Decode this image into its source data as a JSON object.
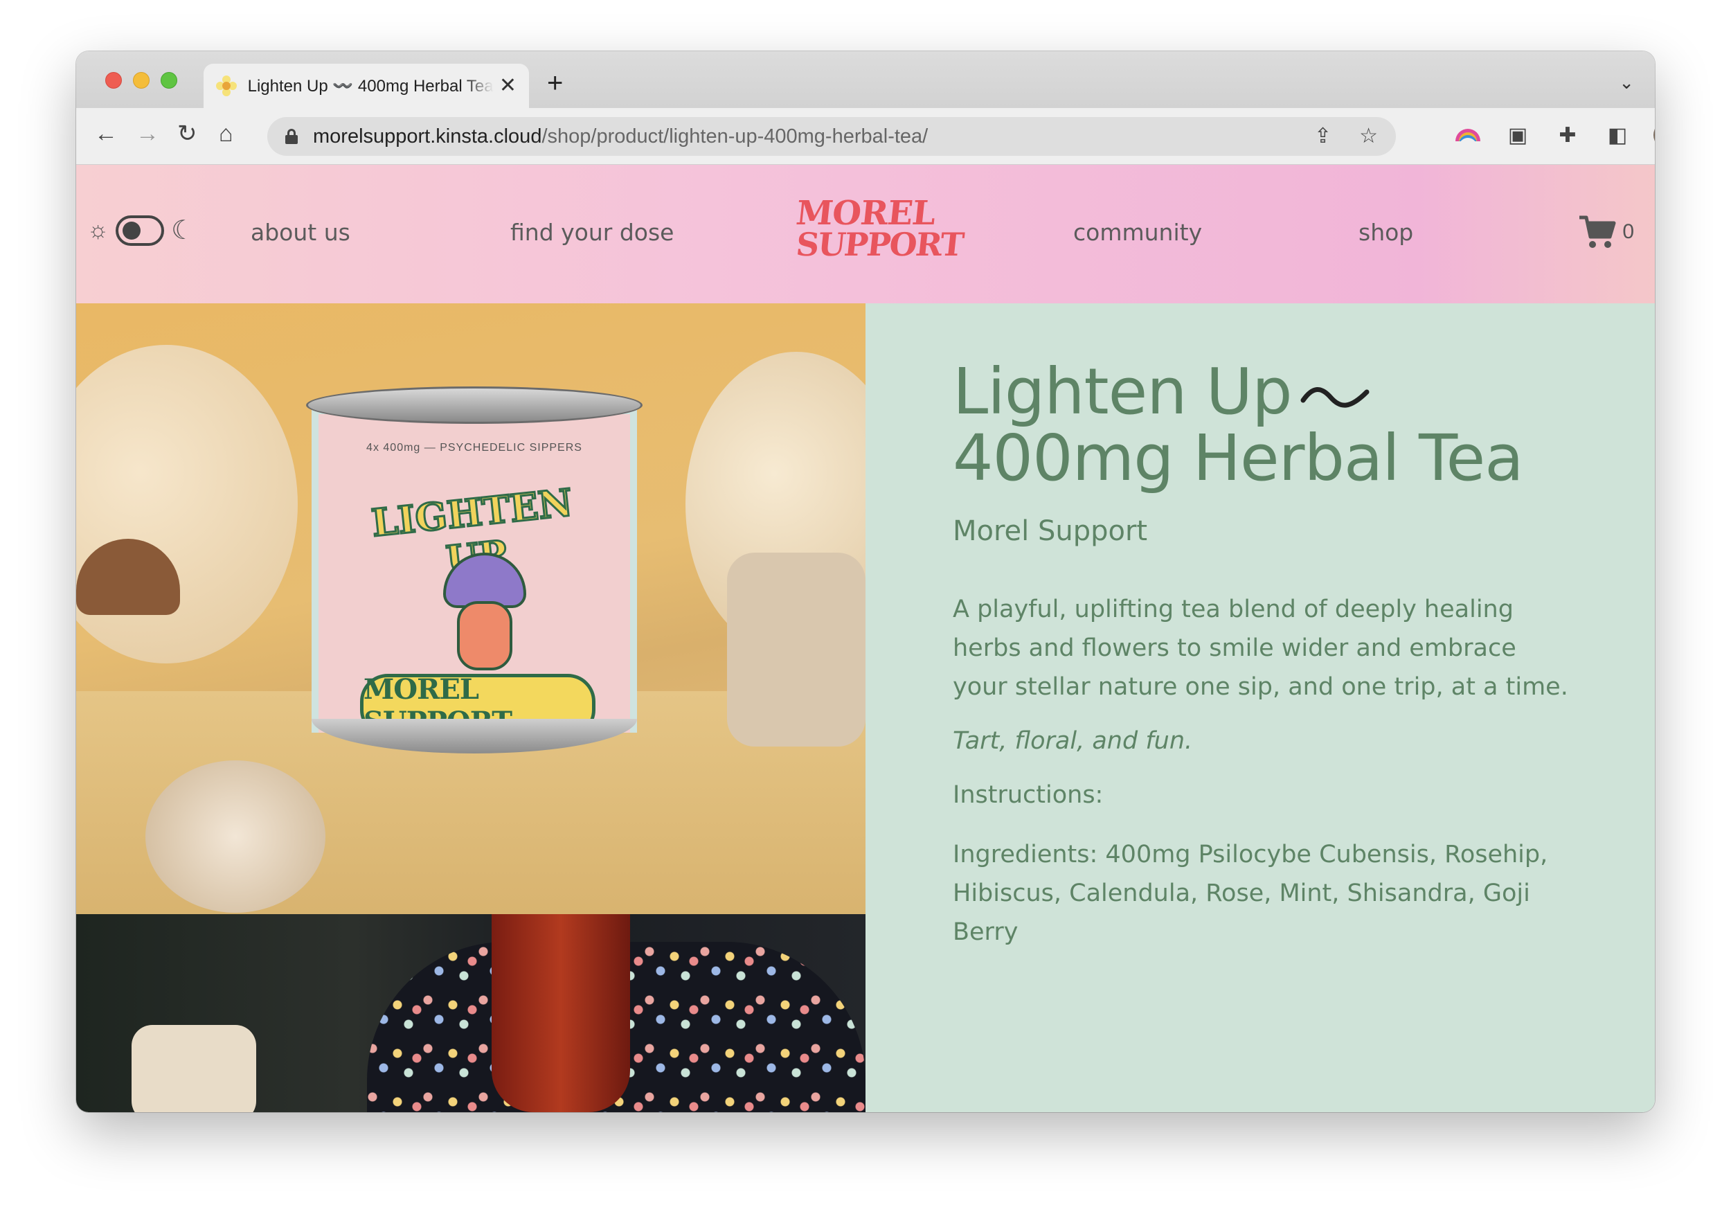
{
  "browser": {
    "tab_title": "Lighten Up 〰️ 400mg Herbal Tea",
    "tab_close": "✕",
    "new_tab": "+",
    "tab_menu": "⌄",
    "url_host": "morelsupport.kinsta.cloud",
    "url_path": "/shop/product/lighten-up-400mg-herbal-tea/",
    "icons": [
      "back-icon",
      "forward-icon",
      "reload-icon",
      "home-icon",
      "lock-icon",
      "share-icon",
      "bookmark-star-icon",
      "extension-rainbow-icon",
      "extension-window-icon",
      "extensions-puzzle-icon",
      "sidebar-icon",
      "profile-avatar",
      "menu-kebab-icon"
    ]
  },
  "header": {
    "nav": {
      "about": "about us",
      "dose": "find your dose",
      "community": "community",
      "shop": "shop"
    },
    "logo_line1": "MOREL",
    "logo_line2": "SUPPORT",
    "cart_count": "0",
    "accent": "#e8555d"
  },
  "product_image": {
    "can_small_text": "4x 400mg — PSYCHEDELIC SIPPERS",
    "can_title": "LIGHTEN UP",
    "can_brand": "MOREL SUPPORT"
  },
  "product": {
    "title_line1": "Lighten Up",
    "title_line2": "400mg Herbal Tea",
    "brand": "Morel Support",
    "description": "A playful, uplifting tea blend of deeply healing herbs and flowers to smile wider and embrace your stellar nature one sip, and one trip, at a time.",
    "tagline": "Tart, floral, and fun.",
    "instructions_label": "Instructions:",
    "ingredients": "Ingredients: 400mg Psilocybe Cubensis, Rosehip, Hibiscus, Calendula, Rose, Mint, Shisandra, Goji Berry",
    "text_color": "#5e8466",
    "panel_color": "#cfe3d8"
  }
}
